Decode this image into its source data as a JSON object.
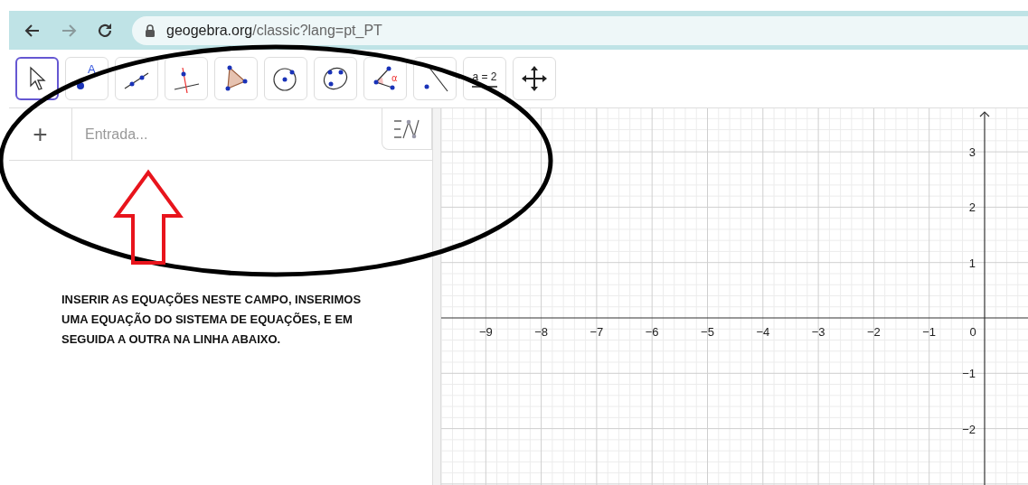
{
  "browser": {
    "forward_disabled": true,
    "url_host": "geogebra.org",
    "url_path": "/classic?lang=pt_PT"
  },
  "toolbar": {
    "tools": [
      {
        "kind": "move",
        "selected": true
      },
      {
        "kind": "point",
        "selected": false,
        "label": "A"
      },
      {
        "kind": "line",
        "selected": false
      },
      {
        "kind": "perpendicular",
        "selected": false
      },
      {
        "kind": "polygon",
        "selected": false
      },
      {
        "kind": "circle",
        "selected": false
      },
      {
        "kind": "conic",
        "selected": false
      },
      {
        "kind": "angle",
        "selected": false,
        "label": "α"
      },
      {
        "kind": "reflect",
        "selected": false
      },
      {
        "kind": "slider",
        "selected": false,
        "label": "a = 2"
      },
      {
        "kind": "pan",
        "selected": false
      }
    ]
  },
  "algebra": {
    "add_label": "+",
    "input": {
      "placeholder": "Entrada..."
    }
  },
  "annotation": {
    "lines": [
      "INSERIR AS EQUAÇÕES NESTE CAMPO, INSERIMOS",
      "UMA EQUAÇÃO DO SISTEMA DE EQUAÇÕES, E EM",
      "SEGUIDA A OUTRA NA LINHA  ABAIXO."
    ]
  },
  "graphics": {
    "x_negative_labels": [
      "−9",
      "−8",
      "−7",
      "−6",
      "−5",
      "−4",
      "−3",
      "−2",
      "−1"
    ],
    "origin_label": "0",
    "y_positive_labels": [
      "3",
      "2",
      "1"
    ],
    "y_negative_labels": [
      "−1",
      "−2"
    ]
  }
}
